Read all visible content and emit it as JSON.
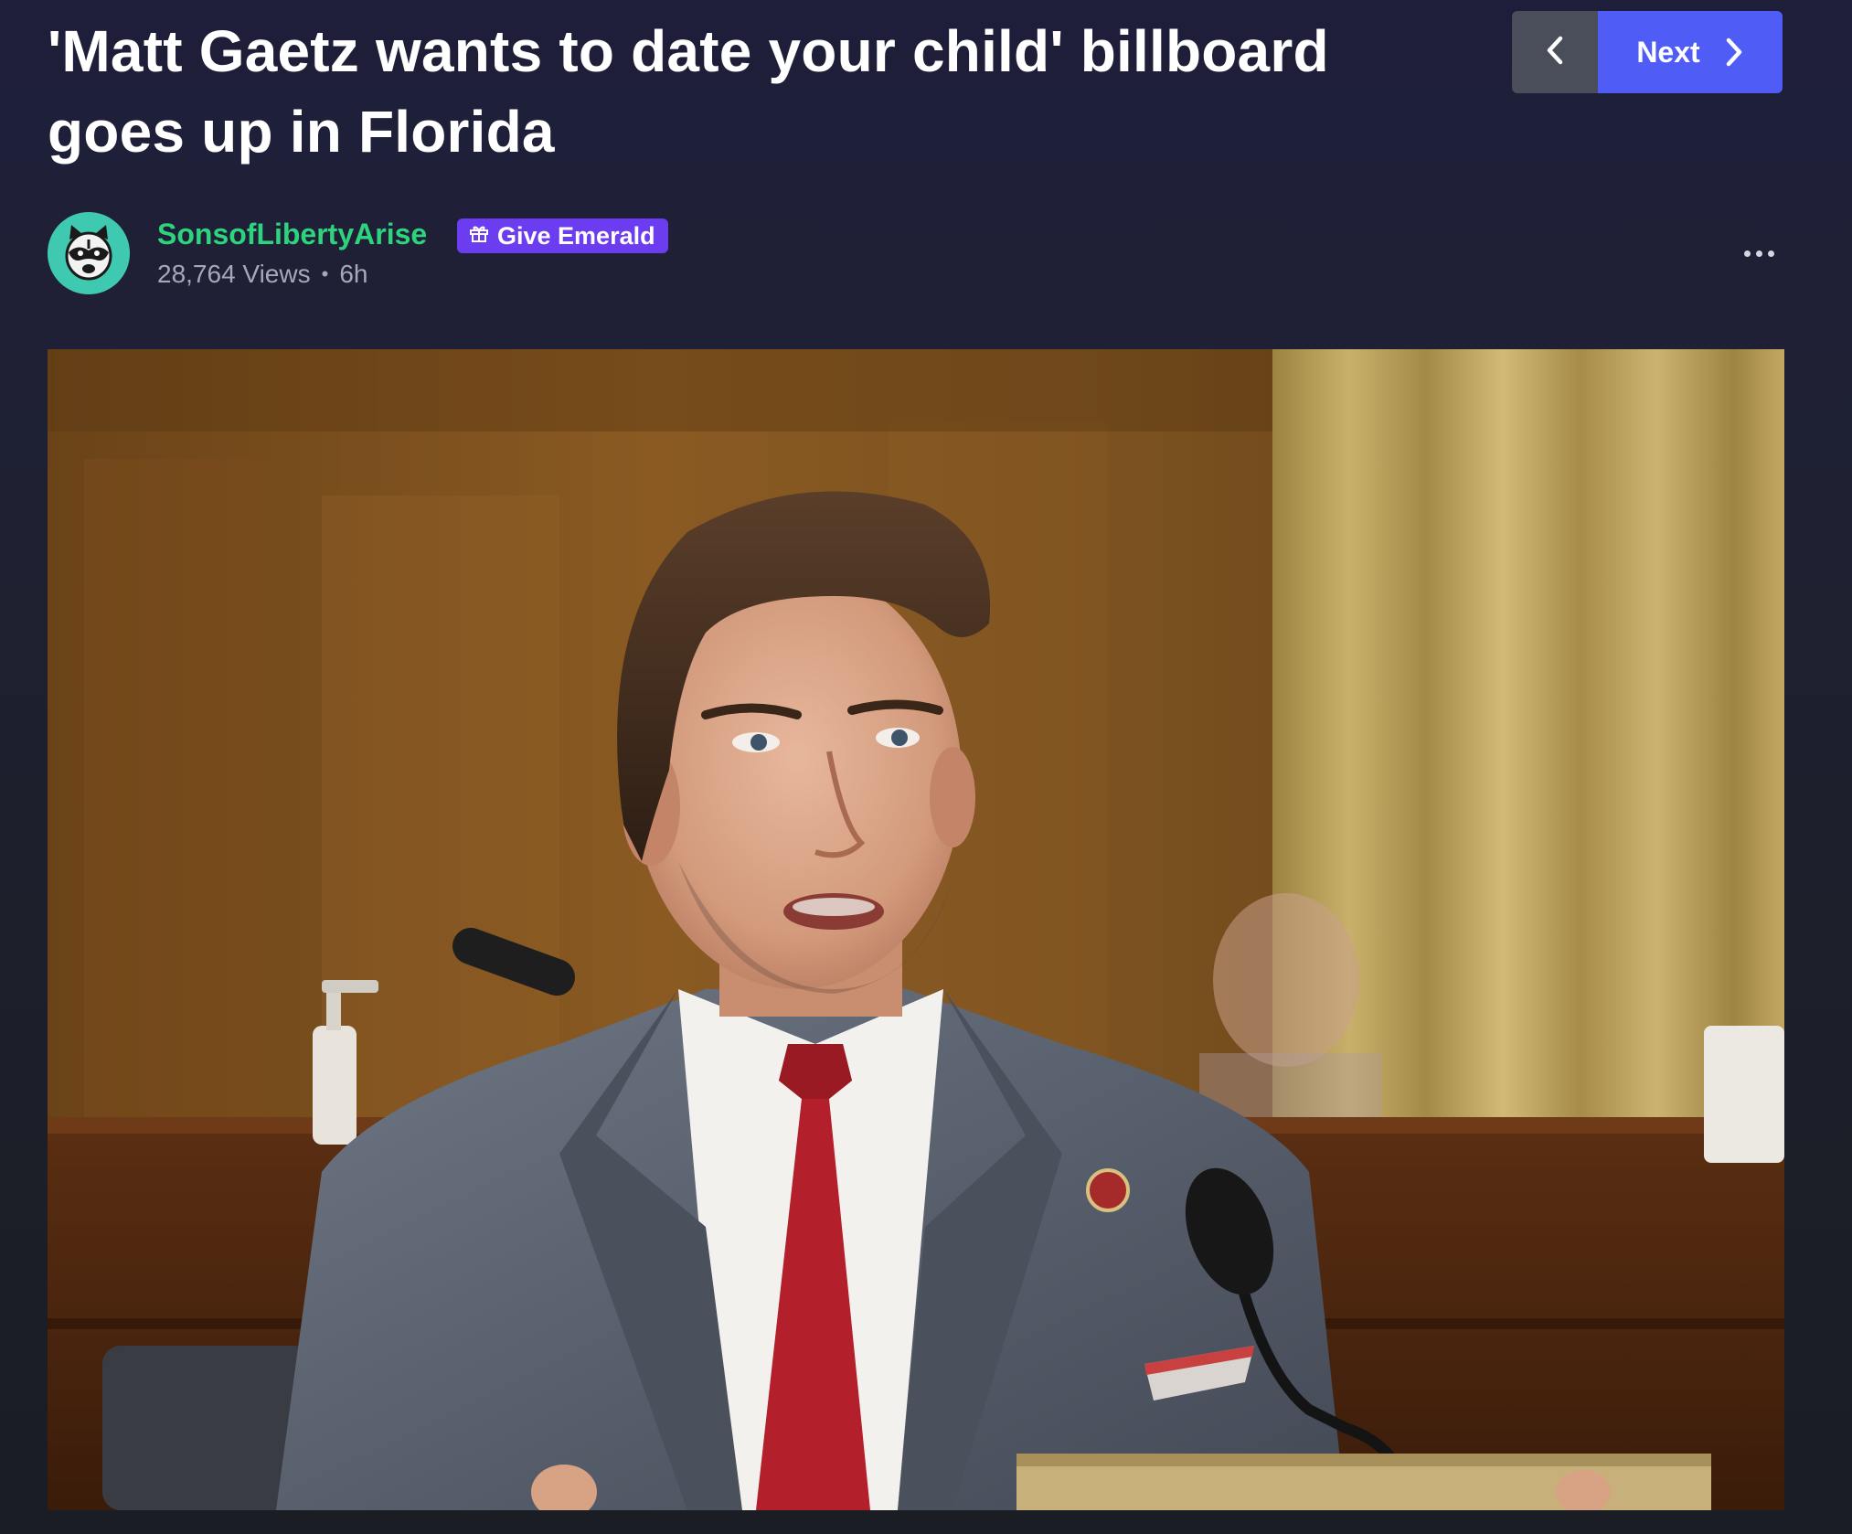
{
  "post": {
    "title": "'Matt Gaetz wants to date your child' billboard goes up in Florida"
  },
  "nav": {
    "next_label": "Next",
    "prev_icon": "chevron-left-icon",
    "next_icon": "chevron-right-icon",
    "next_color": "#4f5cf5",
    "prev_color": "#4a4d5a"
  },
  "author": {
    "username": "SonsofLibertyArise",
    "username_color": "#2ed37e",
    "avatar_icon": "raccoon-avatar",
    "avatar_color": "#3ec9b0",
    "views": "28,764 Views",
    "separator": "•",
    "age": "6h"
  },
  "give_emerald": {
    "label": "Give Emerald",
    "icon": "gift-icon",
    "color": "#6b3cf0"
  },
  "more_menu": {
    "icon": "more-horizontal-icon"
  },
  "photo": {
    "subject": "man in grey suit and red tie speaking at a hearing"
  }
}
